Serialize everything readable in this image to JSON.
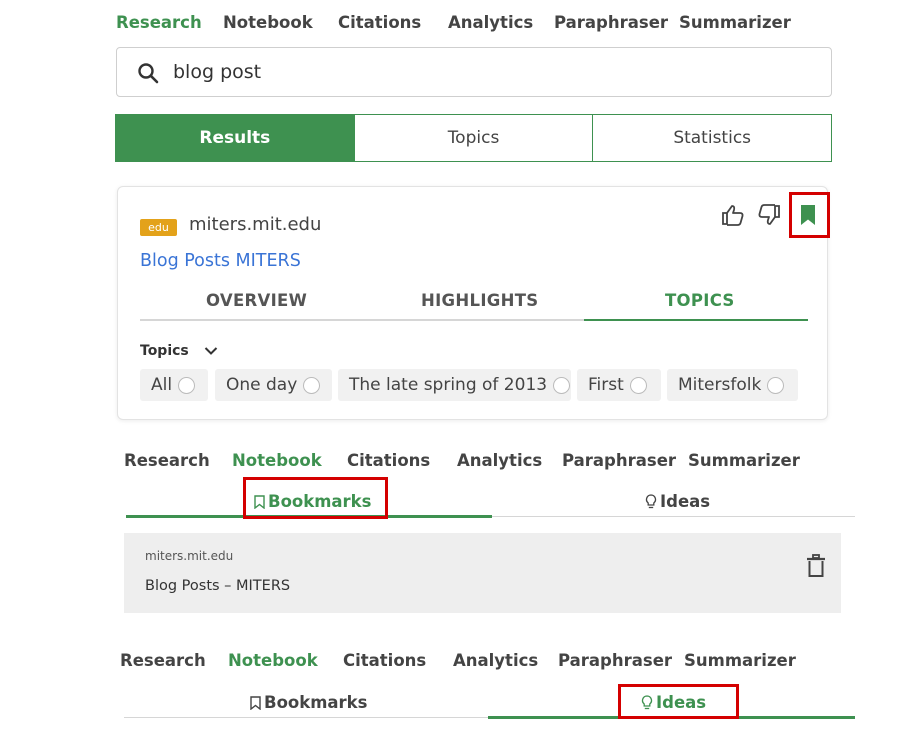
{
  "nav": [
    "Research",
    "Notebook",
    "Citations",
    "Analytics",
    "Paraphraser",
    "Summarizer"
  ],
  "search": {
    "value": "blog post"
  },
  "segments": [
    "Results",
    "Topics",
    "Statistics"
  ],
  "result": {
    "badge": "edu",
    "domain": "miters.mit.edu",
    "title": "Blog Posts MITERS",
    "tabs": [
      "OVERVIEW",
      "HIGHLIGHTS",
      "TOPICS"
    ],
    "topics_label": "Topics",
    "chips": [
      "All",
      "One day",
      "The late spring of 2013",
      "First",
      "Mitersfolk"
    ]
  },
  "notebook": {
    "tabs": [
      "Bookmarks",
      "Ideas"
    ],
    "bookmark": {
      "domain": "miters.mit.edu",
      "title": "Blog Posts – MITERS"
    }
  },
  "colors": {
    "accent": "#3e9150",
    "link": "#3a74d6",
    "badge": "#e3a21a",
    "highlight": "#d40000"
  }
}
